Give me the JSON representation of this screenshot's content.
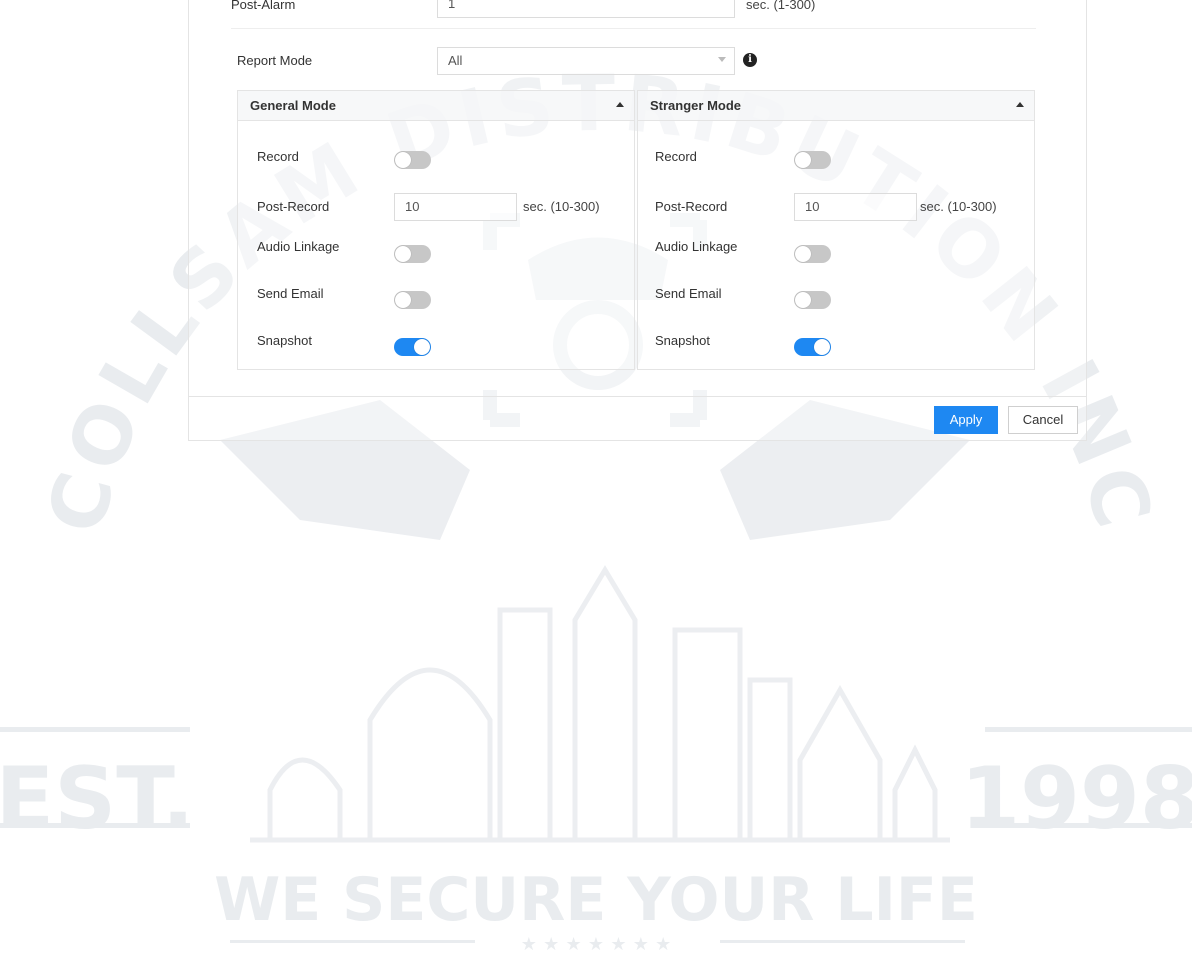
{
  "alarm": {
    "post_alarm_label": "Post-Alarm",
    "post_alarm_value": "1",
    "post_alarm_hint": "sec. (1-300)",
    "report_mode_label": "Report Mode",
    "report_mode_value": "All"
  },
  "general_mode": {
    "title": "General Mode",
    "record_label": "Record",
    "record_on": false,
    "post_record_label": "Post-Record",
    "post_record_value": "10",
    "post_record_hint": "sec. (10-300)",
    "audio_linkage_label": "Audio Linkage",
    "audio_linkage_on": false,
    "send_email_label": "Send Email",
    "send_email_on": false,
    "snapshot_label": "Snapshot",
    "snapshot_on": true
  },
  "stranger_mode": {
    "title": "Stranger Mode",
    "record_label": "Record",
    "record_on": false,
    "post_record_label": "Post-Record",
    "post_record_value": "10",
    "post_record_hint": "sec. (10-300)",
    "audio_linkage_label": "Audio Linkage",
    "audio_linkage_on": false,
    "send_email_label": "Send Email",
    "send_email_on": false,
    "snapshot_label": "Snapshot",
    "snapshot_on": true
  },
  "footer": {
    "apply_label": "Apply",
    "cancel_label": "Cancel"
  },
  "watermark": {
    "arc_text": "COLLSAM DISTRIBUTION INC",
    "left_text": "EST.",
    "right_text": "1998",
    "slogan": "WE SECURE YOUR LIFE",
    "stars": "★ ★ ★ ★ ★ ★ ★"
  },
  "colors": {
    "accent": "#1e88f2",
    "toggle_off": "#c7c7c7",
    "watermark": "#e9ecef"
  }
}
